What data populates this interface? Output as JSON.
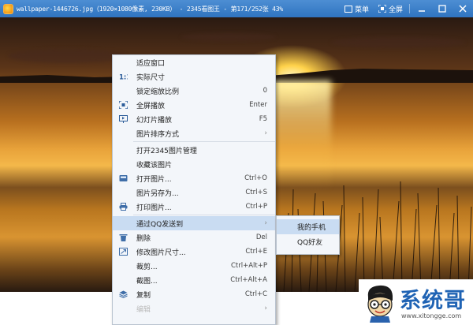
{
  "titlebar": {
    "title": "wallpaper-1446726.jpg（1920×1080像素, 230KB） - 2345看图王 - 第171/252张 43%",
    "menu_label": "菜单",
    "fullscreen_label": "全屏"
  },
  "context_menu": {
    "items": [
      {
        "label": "适应窗口",
        "shortcut": "",
        "icon": ""
      },
      {
        "label": "实际尺寸",
        "shortcut": "",
        "icon": "actual-size-icon"
      },
      {
        "label": "锁定缩放比例",
        "shortcut": "0",
        "icon": ""
      },
      {
        "label": "全屏播放",
        "shortcut": "Enter",
        "icon": "fullscreen-icon"
      },
      {
        "label": "幻灯片播放",
        "shortcut": "F5",
        "icon": "slideshow-icon"
      },
      {
        "label": "图片排序方式",
        "shortcut": "",
        "icon": "",
        "submenu": true
      },
      {
        "label": "打开2345图片管理",
        "shortcut": "",
        "icon": ""
      },
      {
        "label": "收藏该图片",
        "shortcut": "",
        "icon": ""
      },
      {
        "label": "打开图片...",
        "shortcut": "Ctrl+O",
        "icon": "open-icon"
      },
      {
        "label": "图片另存为...",
        "shortcut": "Ctrl+S",
        "icon": ""
      },
      {
        "label": "打印图片...",
        "shortcut": "Ctrl+P",
        "icon": "print-icon"
      },
      {
        "label": "通过QQ发送到",
        "shortcut": "",
        "icon": "",
        "submenu": true
      },
      {
        "label": "删除",
        "shortcut": "Del",
        "icon": "delete-icon"
      },
      {
        "label": "修改图片尺寸...",
        "shortcut": "Ctrl+E",
        "icon": "resize-icon"
      },
      {
        "label": "裁剪...",
        "shortcut": "Ctrl+Alt+P",
        "icon": ""
      },
      {
        "label": "截图...",
        "shortcut": "Ctrl+Alt+A",
        "icon": ""
      },
      {
        "label": "复制",
        "shortcut": "Ctrl+C",
        "icon": "copy-icon"
      },
      {
        "label": "编辑",
        "shortcut": "",
        "icon": "",
        "submenu": true
      }
    ]
  },
  "submenu": {
    "items": [
      {
        "label": "我的手机"
      },
      {
        "label": "QQ好友"
      }
    ]
  },
  "watermark": {
    "title": "系统哥",
    "url": "www.xitongge.com"
  },
  "colors": {
    "titlebar": "#3b7fca",
    "menu_bg": "#f3f6fa",
    "menu_highlight": "#c9dcf2",
    "watermark_blue": "#1f63b4"
  }
}
